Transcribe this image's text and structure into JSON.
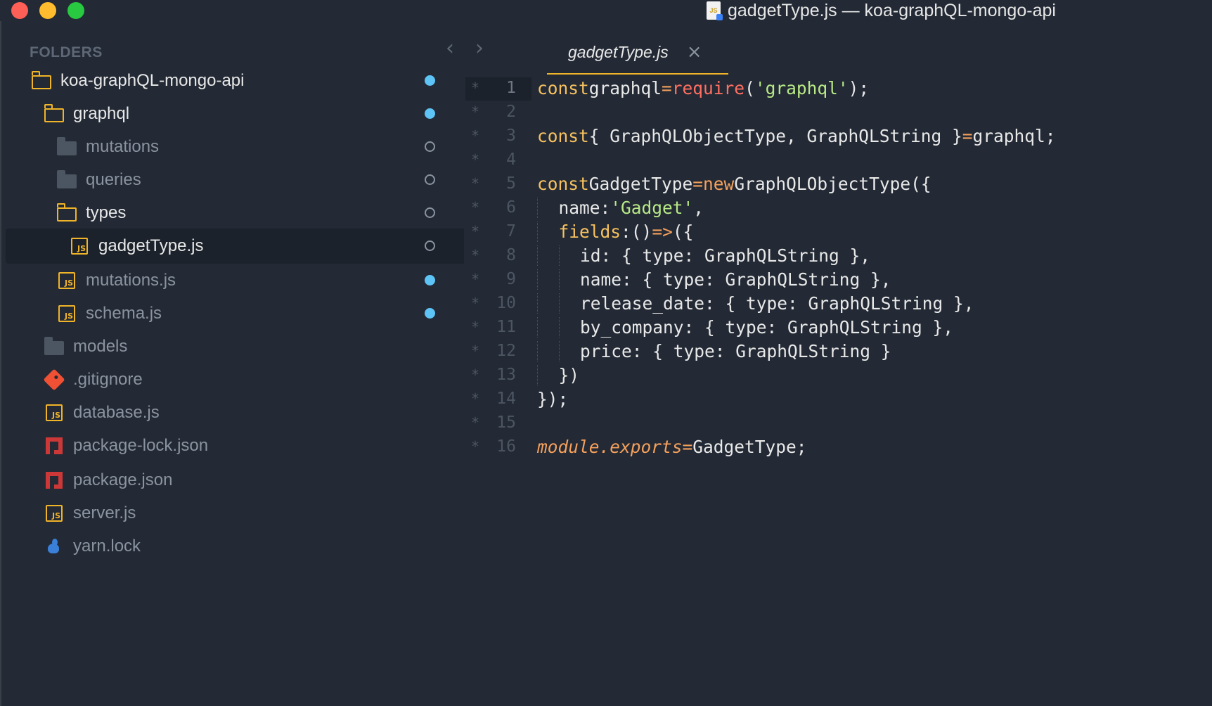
{
  "window": {
    "title": "gadgetType.js — koa-graphQL-mongo-api",
    "title_icon_label": "JS"
  },
  "sidebar": {
    "heading": "FOLDERS",
    "items": [
      {
        "label": "koa-graphQL-mongo-api",
        "icon": "folder-open-icon",
        "indicator": "modified-dot"
      },
      {
        "label": "graphql",
        "icon": "folder-open-icon",
        "indicator": "modified-dot"
      },
      {
        "label": "mutations",
        "icon": "folder-closed-icon",
        "indicator": "ring"
      },
      {
        "label": "queries",
        "icon": "folder-closed-icon",
        "indicator": "ring"
      },
      {
        "label": "types",
        "icon": "folder-open-icon",
        "indicator": "ring"
      },
      {
        "label": "gadgetType.js",
        "icon": "js-file-icon",
        "indicator": "ring",
        "selected": true
      },
      {
        "label": "mutations.js",
        "icon": "js-file-icon",
        "indicator": "modified-dot"
      },
      {
        "label": "schema.js",
        "icon": "js-file-icon",
        "indicator": "modified-dot"
      },
      {
        "label": "models",
        "icon": "folder-closed-icon",
        "indicator": "none"
      },
      {
        "label": ".gitignore",
        "icon": "git-icon",
        "indicator": "none"
      },
      {
        "label": "database.js",
        "icon": "js-file-icon",
        "indicator": "none"
      },
      {
        "label": "package-lock.json",
        "icon": "npm-icon",
        "indicator": "none"
      },
      {
        "label": "package.json",
        "icon": "npm-icon",
        "indicator": "none"
      },
      {
        "label": "server.js",
        "icon": "js-file-icon",
        "indicator": "none"
      },
      {
        "label": "yarn.lock",
        "icon": "yarn-icon",
        "indicator": "none"
      }
    ]
  },
  "editor": {
    "nav_back": "‹",
    "nav_forward": "›",
    "tab": {
      "label": "gadgetType.js",
      "close": "×"
    },
    "gutter_marker": "*",
    "line_numbers": [
      "1",
      "2",
      "3",
      "4",
      "5",
      "6",
      "7",
      "8",
      "9",
      "10",
      "11",
      "12",
      "13",
      "14",
      "15",
      "16"
    ],
    "code": {
      "l1": {
        "kw": "const",
        "name": "graphql",
        "op": "=",
        "fn": "require",
        "p1": "(",
        "str": "'graphql'",
        "p2": ");"
      },
      "l3": {
        "kw": "const",
        "body": "{ GraphQLObjectType, GraphQLString }",
        "op": "=",
        "rest": "graphql;"
      },
      "l5": {
        "kw": "const",
        "name": "GadgetType",
        "op": "=",
        "kw2": "new",
        "rest": "GraphQLObjectType({"
      },
      "l6": {
        "key": "name:",
        "str": "'Gadget'",
        "rest": ","
      },
      "l7": {
        "key": "fields",
        "colon": ":",
        "paren": "()",
        "arrow": "=>",
        "rest": "({"
      },
      "l8": "id: { type: GraphQLString },",
      "l9": "name: { type: GraphQLString },",
      "l10": "release_date: { type: GraphQLString },",
      "l11": "by_company: { type: GraphQLString },",
      "l12": "price: { type: GraphQLString }",
      "l13": "})",
      "l14": "});",
      "l16": {
        "it": "module.exports",
        "op": "=",
        "rest": "GadgetType;"
      }
    }
  },
  "colors": {
    "background": "#232a35",
    "accent_yellow": "#f0b429",
    "modified_dot": "#5ec4f5",
    "string_green": "#b8e986",
    "function_red": "#ff6f61"
  }
}
